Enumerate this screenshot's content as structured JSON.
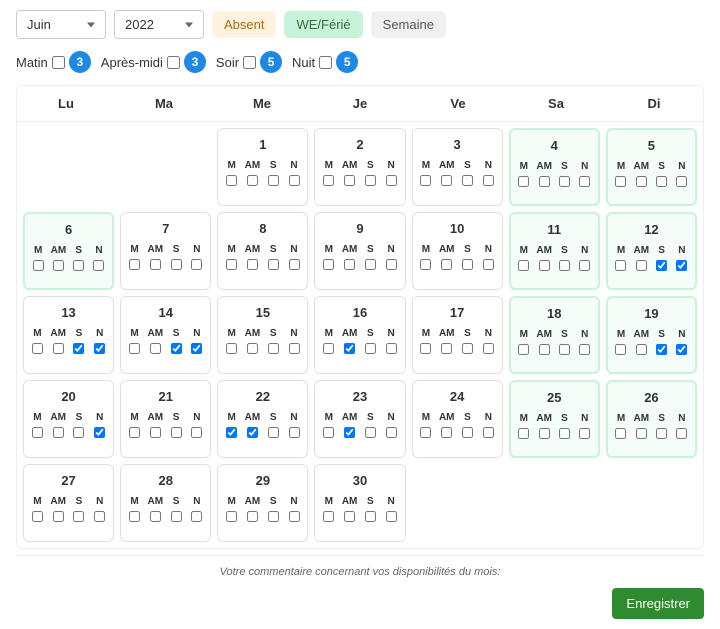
{
  "topbar": {
    "month": "Juin",
    "year": "2022",
    "chips": {
      "absent": "Absent",
      "we": "WE/Férié",
      "semaine": "Semaine"
    }
  },
  "counts": {
    "labels": {
      "matin": "Matin",
      "apresmidi": "Après-midi",
      "soir": "Soir",
      "nuit": "Nuit"
    },
    "values": {
      "matin": 3,
      "apresmidi": 3,
      "soir": 5,
      "nuit": 5
    }
  },
  "calendar": {
    "headers": [
      "Lu",
      "Ma",
      "Me",
      "Je",
      "Ve",
      "Sa",
      "Di"
    ],
    "slotLabels": [
      "M",
      "AM",
      "S",
      "N"
    ],
    "days": [
      {
        "num": "",
        "empty": true
      },
      {
        "num": "",
        "empty": true
      },
      {
        "num": 1,
        "we": false,
        "m": false,
        "am": false,
        "s": false,
        "n": false
      },
      {
        "num": 2,
        "we": false,
        "m": false,
        "am": false,
        "s": false,
        "n": false
      },
      {
        "num": 3,
        "we": false,
        "m": false,
        "am": false,
        "s": false,
        "n": false
      },
      {
        "num": 4,
        "we": true,
        "m": false,
        "am": false,
        "s": false,
        "n": false
      },
      {
        "num": 5,
        "we": true,
        "m": false,
        "am": false,
        "s": false,
        "n": false
      },
      {
        "num": 6,
        "we": true,
        "m": false,
        "am": false,
        "s": false,
        "n": false
      },
      {
        "num": 7,
        "we": false,
        "m": false,
        "am": false,
        "s": false,
        "n": false
      },
      {
        "num": 8,
        "we": false,
        "m": false,
        "am": false,
        "s": false,
        "n": false
      },
      {
        "num": 9,
        "we": false,
        "m": false,
        "am": false,
        "s": false,
        "n": false
      },
      {
        "num": 10,
        "we": false,
        "m": false,
        "am": false,
        "s": false,
        "n": false
      },
      {
        "num": 11,
        "we": true,
        "m": false,
        "am": false,
        "s": false,
        "n": false
      },
      {
        "num": 12,
        "we": true,
        "m": false,
        "am": false,
        "s": true,
        "n": true
      },
      {
        "num": 13,
        "we": false,
        "m": false,
        "am": false,
        "s": true,
        "n": true
      },
      {
        "num": 14,
        "we": false,
        "m": false,
        "am": false,
        "s": true,
        "n": true
      },
      {
        "num": 15,
        "we": false,
        "m": false,
        "am": false,
        "s": false,
        "n": false
      },
      {
        "num": 16,
        "we": false,
        "m": false,
        "am": true,
        "s": false,
        "n": false
      },
      {
        "num": 17,
        "we": false,
        "m": false,
        "am": false,
        "s": false,
        "n": false
      },
      {
        "num": 18,
        "we": true,
        "m": false,
        "am": false,
        "s": false,
        "n": false
      },
      {
        "num": 19,
        "we": true,
        "m": false,
        "am": false,
        "s": true,
        "n": true
      },
      {
        "num": 20,
        "we": false,
        "m": false,
        "am": false,
        "s": false,
        "n": true
      },
      {
        "num": 21,
        "we": false,
        "m": false,
        "am": false,
        "s": false,
        "n": false
      },
      {
        "num": 22,
        "we": false,
        "m": true,
        "am": true,
        "s": false,
        "n": false
      },
      {
        "num": 23,
        "we": false,
        "m": false,
        "am": true,
        "s": false,
        "n": false
      },
      {
        "num": 24,
        "we": false,
        "m": false,
        "am": false,
        "s": false,
        "n": false
      },
      {
        "num": 25,
        "we": true,
        "m": false,
        "am": false,
        "s": false,
        "n": false
      },
      {
        "num": 26,
        "we": true,
        "m": false,
        "am": false,
        "s": false,
        "n": false
      },
      {
        "num": 27,
        "we": false,
        "m": false,
        "am": false,
        "s": false,
        "n": false
      },
      {
        "num": 28,
        "we": false,
        "m": false,
        "am": false,
        "s": false,
        "n": false
      },
      {
        "num": 29,
        "we": false,
        "m": false,
        "am": false,
        "s": false,
        "n": false
      },
      {
        "num": 30,
        "we": false,
        "m": false,
        "am": false,
        "s": false,
        "n": false
      }
    ]
  },
  "bottom": {
    "commentLabel": "Votre commentaire concernant vos disponibilités du mois:",
    "save": "Enregistrer"
  }
}
